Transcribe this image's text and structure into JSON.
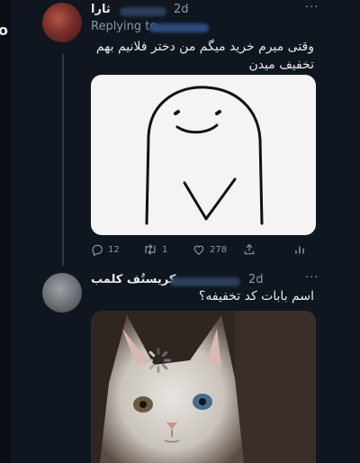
{
  "left_glyph": "ο",
  "tweet1": {
    "name": "ثارا",
    "time": "2d",
    "more": "···",
    "replying_label": "Replying to",
    "text": "وقتی میرم خرید میگم من دختر فلانیم بهم تخفیف میدن",
    "media_icon": "drawn-blob-face-heart",
    "actions": {
      "reply_count": "12",
      "retweet_count": "1",
      "like_count": "278",
      "reply_icon": "reply-icon",
      "retweet_icon": "retweet-icon",
      "like_icon": "heart-icon",
      "share_icon": "share-icon",
      "analytics_icon": "analytics-icon"
    }
  },
  "tweet2": {
    "name": "کریستُف کلمب",
    "time": "2d",
    "more": "···",
    "text": "اسم بابات کد تخفیفه؟",
    "media_icon": "white-kitten-loading"
  },
  "colors": {
    "background": "#0f1620",
    "text": "#e7e9ea",
    "muted": "#8b98a5",
    "thread_line": "#2f3a45"
  }
}
